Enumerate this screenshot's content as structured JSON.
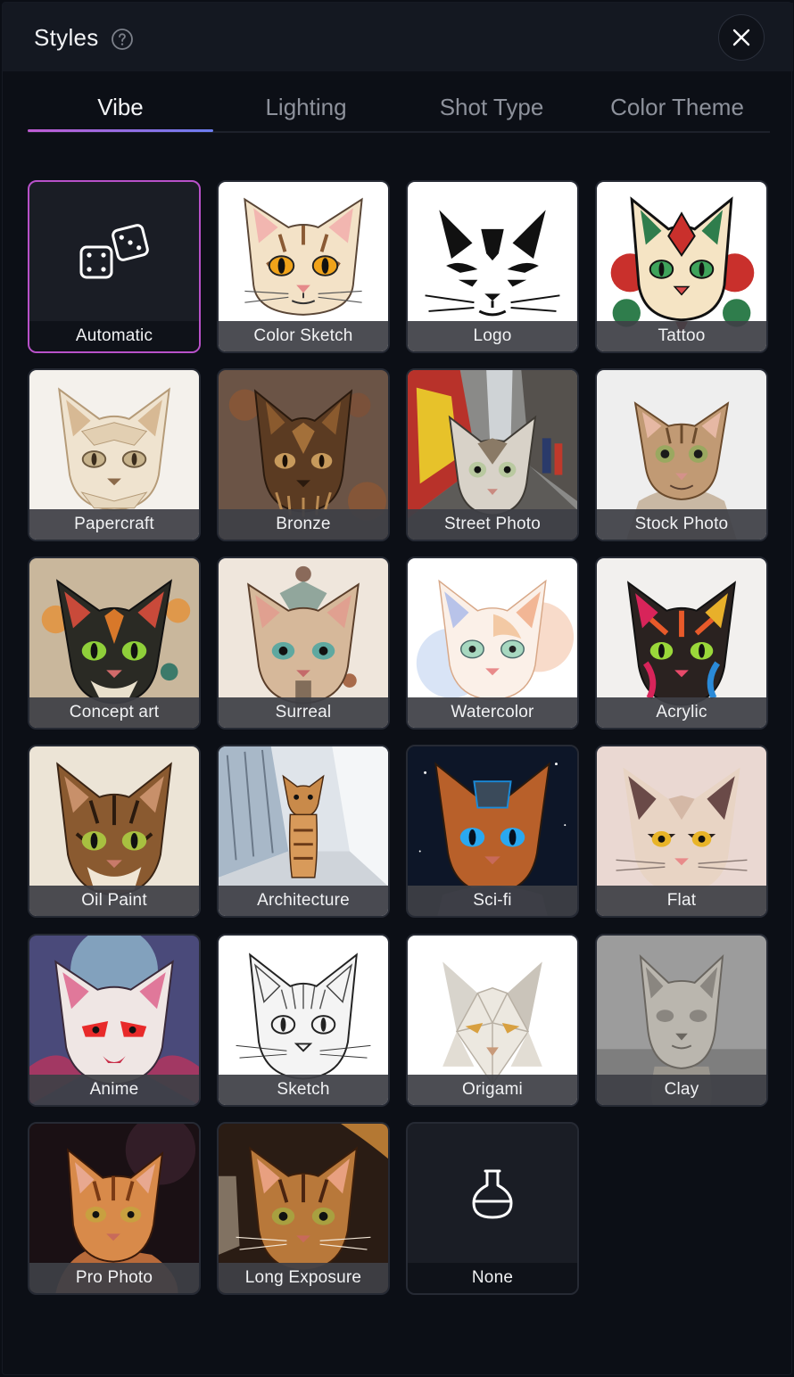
{
  "header": {
    "title": "Styles",
    "help_icon": "help-circle-icon",
    "close_icon": "close-icon"
  },
  "tabs": [
    {
      "label": "Vibe",
      "active": true
    },
    {
      "label": "Lighting",
      "active": false
    },
    {
      "label": "Shot Type",
      "active": false
    },
    {
      "label": "Color Theme",
      "active": false
    }
  ],
  "accent_colors": {
    "selected_border": "#b851c9",
    "tab_gradient_start": "#c15bd3",
    "tab_gradient_end": "#6b7df0"
  },
  "styles": [
    {
      "label": "Automatic",
      "icon": "dice-icon",
      "selected": true
    },
    {
      "label": "Color Sketch"
    },
    {
      "label": "Logo"
    },
    {
      "label": "Tattoo"
    },
    {
      "label": "Papercraft"
    },
    {
      "label": "Bronze"
    },
    {
      "label": "Street Photo"
    },
    {
      "label": "Stock Photo"
    },
    {
      "label": "Concept art"
    },
    {
      "label": "Surreal"
    },
    {
      "label": "Watercolor"
    },
    {
      "label": "Acrylic"
    },
    {
      "label": "Oil Paint"
    },
    {
      "label": "Architecture"
    },
    {
      "label": "Sci-fi"
    },
    {
      "label": "Flat"
    },
    {
      "label": "Anime"
    },
    {
      "label": "Sketch"
    },
    {
      "label": "Origami"
    },
    {
      "label": "Clay"
    },
    {
      "label": "Pro Photo"
    },
    {
      "label": "Long Exposure"
    },
    {
      "label": "None",
      "icon": "flask-icon"
    }
  ]
}
